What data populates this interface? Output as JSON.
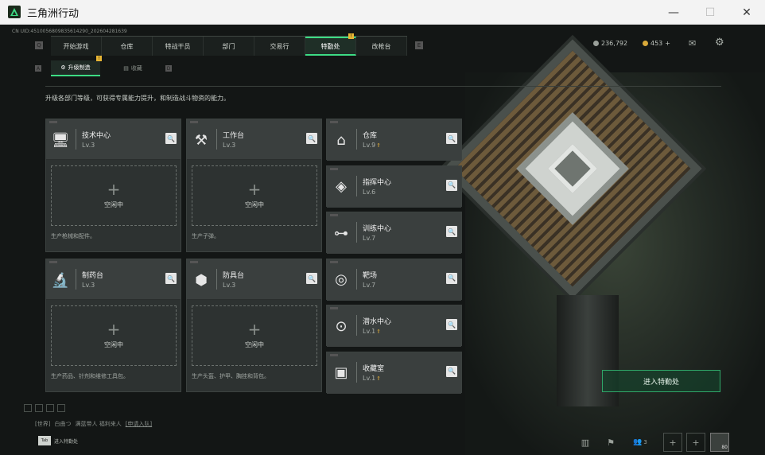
{
  "window": {
    "title": "三角洲行动",
    "minimize": "—",
    "maximize": "☐",
    "close": "✕"
  },
  "uid": "CN UID:4510056809835614290_202604281639",
  "topnav": {
    "left_key": "Q",
    "right_key": "E",
    "tabs": [
      {
        "label": "开始游戏",
        "active": false
      },
      {
        "label": "仓库",
        "active": false
      },
      {
        "label": "特战干员",
        "active": false
      },
      {
        "label": "部门",
        "active": false
      },
      {
        "label": "交易行",
        "active": false
      },
      {
        "label": "特勤处",
        "active": true,
        "badge": "!"
      },
      {
        "label": "改枪台",
        "active": false
      }
    ]
  },
  "currency": {
    "silver": "236,792",
    "gold": "453",
    "gold_add": "+"
  },
  "subnav": {
    "left_key": "A",
    "right_key": "D",
    "tabs": [
      {
        "label": "升级制造",
        "active": true,
        "badge": "!"
      },
      {
        "label": "收藏",
        "active": false
      }
    ]
  },
  "description": "升级各部门等级，可获得专属能力提升，和制造战斗物资的能力。",
  "workshops": [
    {
      "name": "技术中心",
      "level": "Lv.3",
      "icon": "computer-icon",
      "glyph": "🖥",
      "slot": "空闲中",
      "footer": "生产枪械和配件。"
    },
    {
      "name": "工作台",
      "level": "Lv.3",
      "icon": "tools-icon",
      "glyph": "⚒",
      "slot": "空闲中",
      "footer": "生产子弹。"
    },
    {
      "name": "制药台",
      "level": "Lv.3",
      "icon": "microscope-icon",
      "glyph": "🔬",
      "slot": "空闲中",
      "footer": "生产药品、针剂和维修工具包。"
    },
    {
      "name": "防具台",
      "level": "Lv.3",
      "icon": "armor-materials-icon",
      "glyph": "⬢",
      "slot": "空闲中",
      "footer": "生产头盔、护甲、胸挂和背包。"
    }
  ],
  "facilities": [
    {
      "name": "仓库",
      "level": "Lv.9",
      "upgradable": true,
      "icon": "warehouse-icon",
      "glyph": "⌂"
    },
    {
      "name": "指挥中心",
      "level": "Lv.6",
      "upgradable": false,
      "icon": "chip-icon",
      "glyph": "◈"
    },
    {
      "name": "训练中心",
      "level": "Lv.7",
      "upgradable": false,
      "icon": "dumbbell-icon",
      "glyph": "⊶"
    },
    {
      "name": "靶场",
      "level": "Lv.7",
      "upgradable": false,
      "icon": "target-icon",
      "glyph": "◎"
    },
    {
      "name": "潜水中心",
      "level": "Lv.1",
      "upgradable": true,
      "icon": "diving-mask-icon",
      "glyph": "⊙"
    },
    {
      "name": "收藏室",
      "level": "Lv.1",
      "upgradable": true,
      "icon": "collection-icon",
      "glyph": "▣"
    }
  ],
  "enter_button": "进入特勤处",
  "chat": {
    "channel": "[世界]",
    "player": "白曲つ",
    "message": "满蓝带人 福利来人",
    "link": "[申请入队]"
  },
  "bottom": {
    "tab_key": "Tab",
    "tab_label": "进入特勤处",
    "friends_count": "3",
    "avatar_level": "80"
  },
  "colors": {
    "accent": "#3ddc84",
    "upgrade": "#d8a83a"
  }
}
